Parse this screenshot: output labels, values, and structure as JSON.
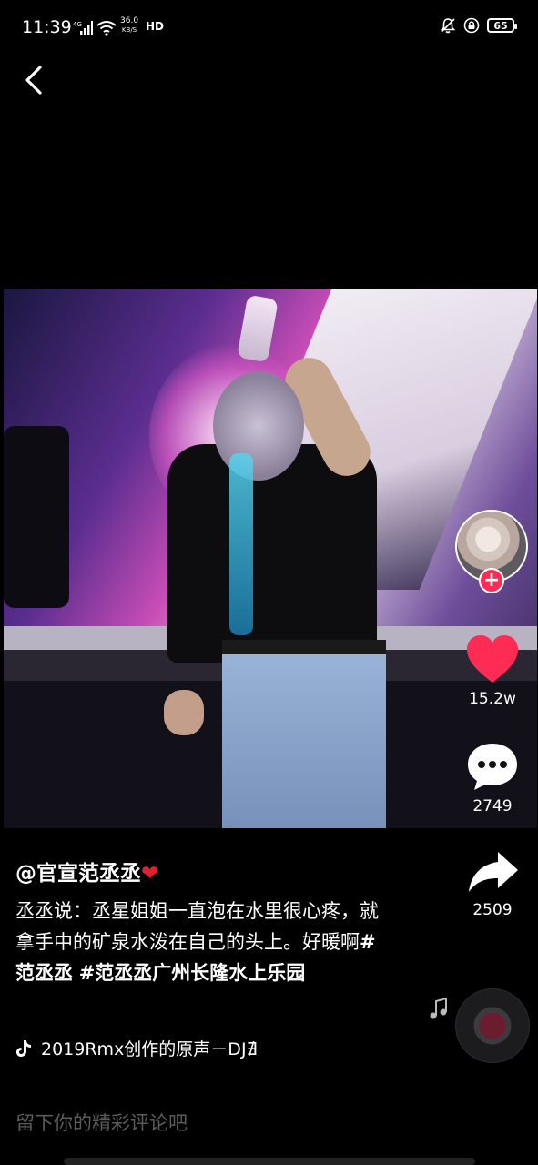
{
  "status_bar": {
    "time": "11:39",
    "network": "4G",
    "speed_value": "36.0",
    "speed_unit": "KB/S",
    "hd": "HD",
    "battery": "65"
  },
  "actions": {
    "likes": "15.2w",
    "comments": "2749",
    "shares": "2509"
  },
  "colors": {
    "like": "#fe2c55",
    "follow": "#fe2c55",
    "background": "#000000"
  },
  "caption": {
    "author": "@官宣范丞丞",
    "text_plain": "丞丞说：丞星姐姐一直泡在水里很心疼，就拿手中的矿泉水泼在自己的头上。好暖啊",
    "tag1": "#范丞丞",
    "tag2": "#范丞丞广州长隆水上乐园"
  },
  "music": {
    "title": "2019Rmx创作的原声－DJ∄"
  },
  "comment": {
    "placeholder": "留下你的精彩评论吧"
  },
  "icons": [
    "back-icon",
    "signal-icon",
    "wifi-icon",
    "mute-icon",
    "lock-icon",
    "battery-icon",
    "heart-icon",
    "comment-icon",
    "share-icon",
    "music-note-icon",
    "tiktok-icon"
  ]
}
